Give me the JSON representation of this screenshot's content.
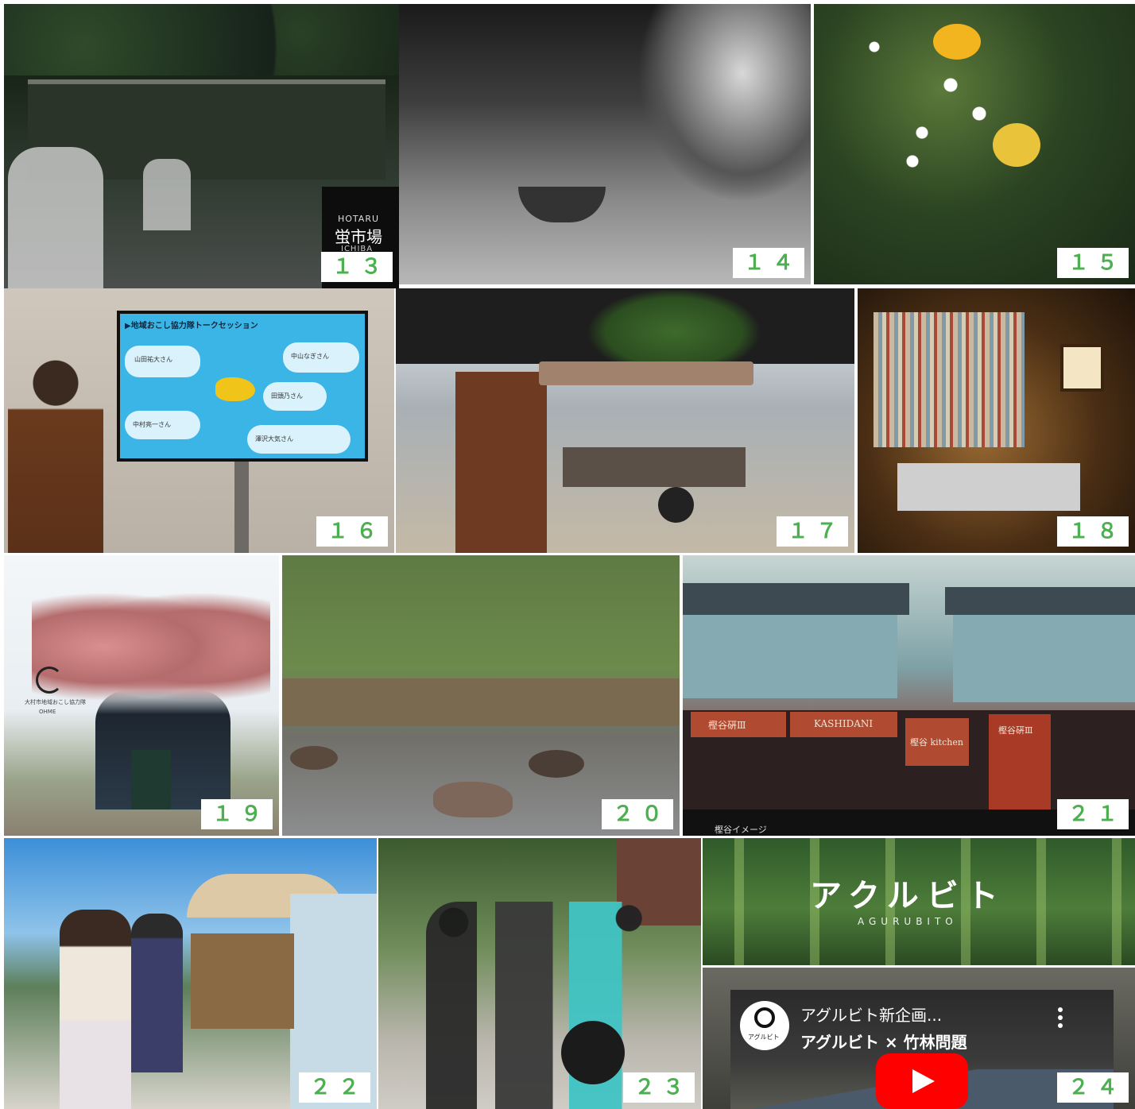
{
  "tiles": {
    "t13": {
      "number": "１３",
      "caption_top": "HOTARU",
      "caption": "蛍市場",
      "caption_bottom": "ICHIBA"
    },
    "t14": {
      "number": "１４"
    },
    "t15": {
      "number": "１５"
    },
    "t16": {
      "number": "１６",
      "slide_title": "▶地域おこし協力隊トークセッション",
      "bubbles": [
        "山田祐大さん",
        "中山なぎさん",
        "田頭乃さん",
        "中村亮一さん",
        "澤沢大気さん"
      ]
    },
    "t17": {
      "number": "１７"
    },
    "t18": {
      "number": "１８"
    },
    "t19": {
      "number": "１９",
      "logo_text": "大村市地域おこし協力隊",
      "logo_sub": "OHME"
    },
    "t20": {
      "number": "２０"
    },
    "t21": {
      "number": "２１",
      "signs": [
        "樫谷硏Ⅲ",
        "KASHIDANI",
        "樫谷 kitchen",
        "樫谷硏Ⅲ"
      ],
      "caption": "樫谷イメージ"
    },
    "t22": {
      "number": "２２"
    },
    "t23": {
      "number": "２３"
    },
    "t24": {
      "number": "２４",
      "banner_title": "アクルビト",
      "banner_sub": "AGURUBITO",
      "video_title": "アグルビト新企画...",
      "video_sub": "アグルビト × 竹林問題",
      "channel_label": "アグルビト"
    }
  },
  "colors": {
    "number_text": "#4caf50",
    "number_bg": "#ffffff",
    "youtube_red": "#ff0000"
  },
  "icons": {
    "play": "play-icon",
    "more": "more-vertical-icon"
  }
}
